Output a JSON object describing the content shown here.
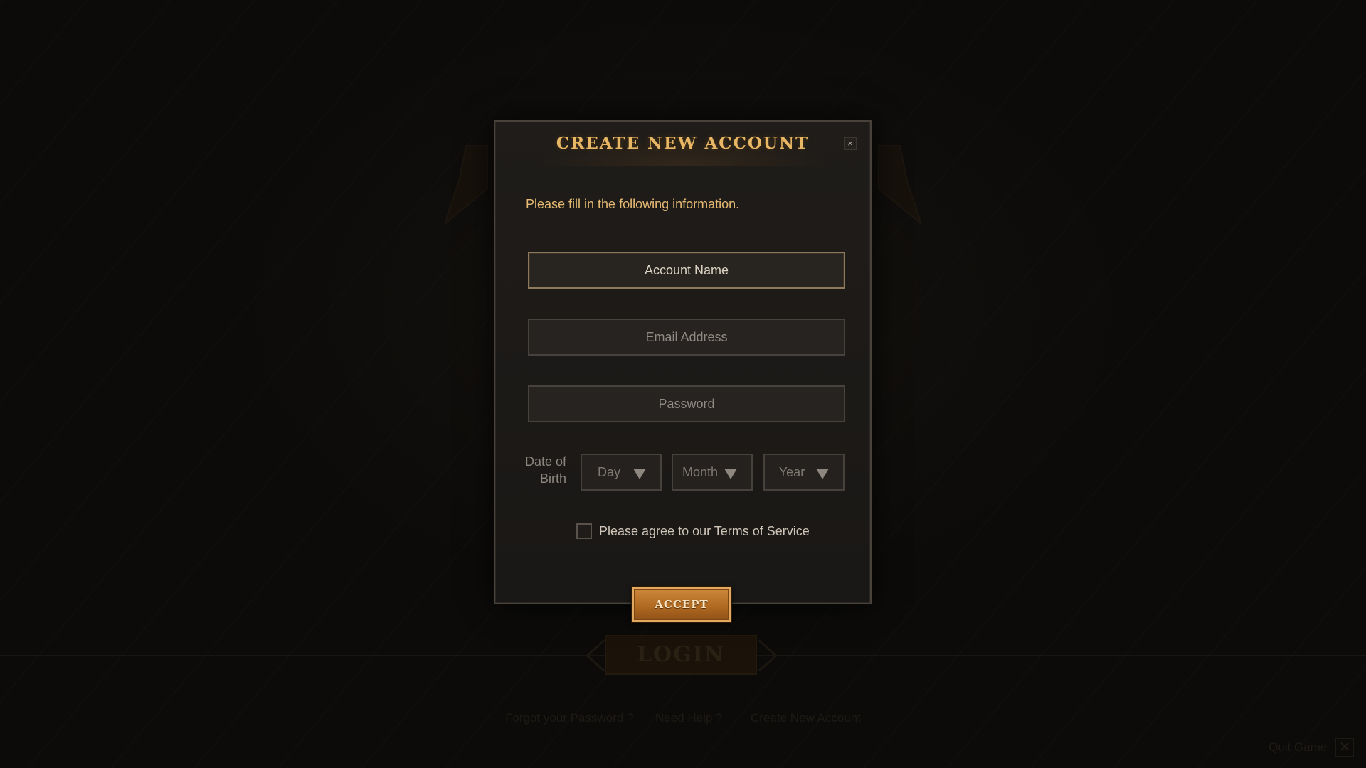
{
  "background": {
    "login_label": "LOGIN",
    "links": [
      "Forgot your Password ?",
      "Need Help ?",
      "Create New Account"
    ],
    "quit_label": "Quit Game"
  },
  "modal": {
    "title": "CREATE NEW ACCOUNT",
    "close_label": "×",
    "intro": "Please fill in the following information.",
    "fields": {
      "account_name": "Account Name",
      "email": "Email Address",
      "password": "Password"
    },
    "dob": {
      "label_line1": "Date of",
      "label_line2": "Birth",
      "day": "Day",
      "month": "Month",
      "year": "Year"
    },
    "tos_label": "Please agree to our Terms of Service",
    "tos_checked": false,
    "accept_label": "ACCEPT"
  },
  "colors": {
    "accent": "#e7b766",
    "button": "#b06a22"
  }
}
